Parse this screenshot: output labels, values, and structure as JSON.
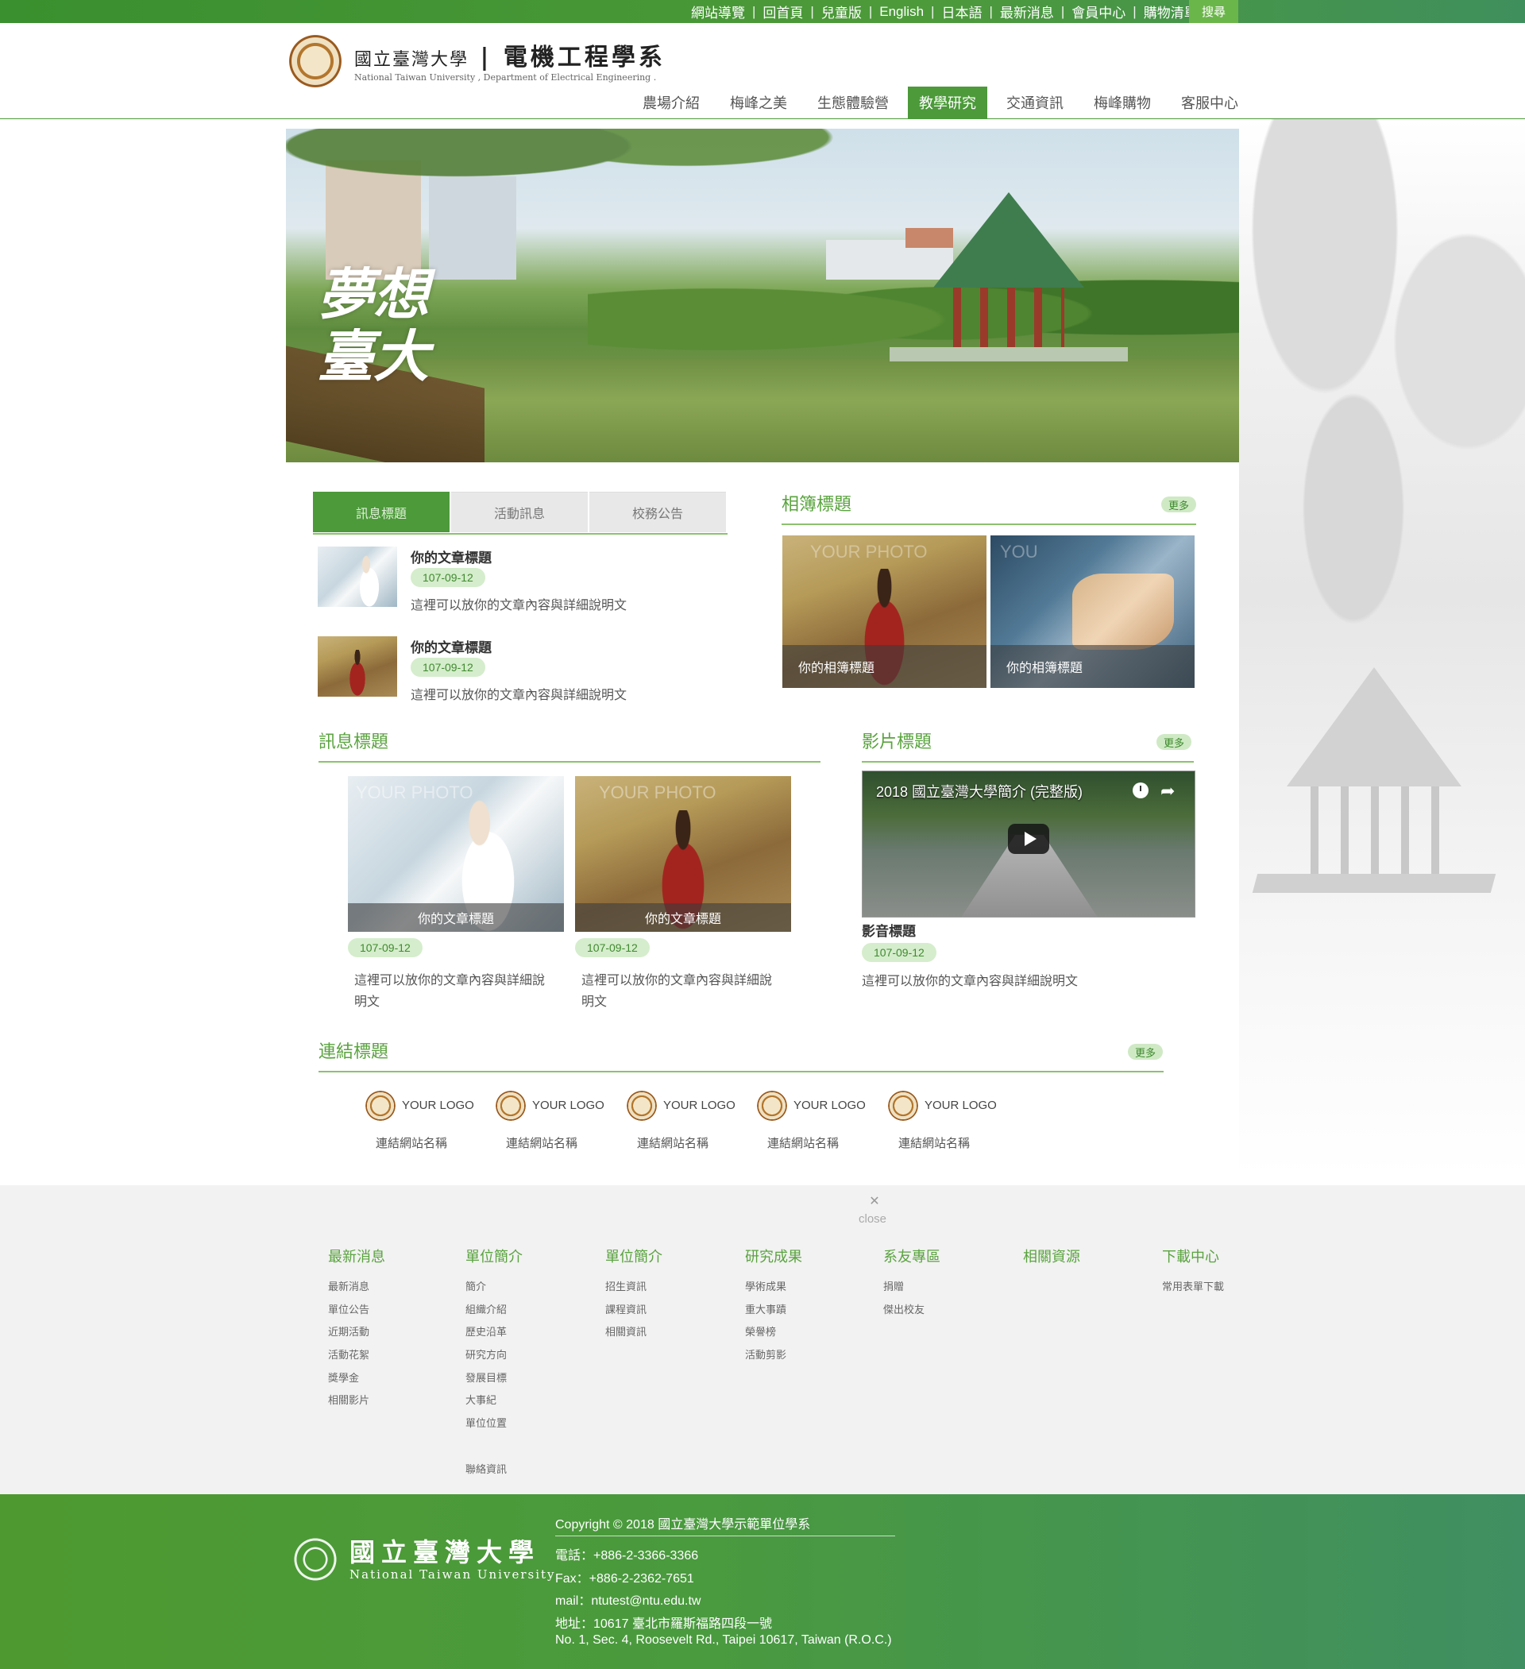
{
  "topbar": {
    "links": [
      "網站導覽",
      "回首頁",
      "兒童版",
      "English",
      "日本語",
      "最新消息",
      "會員中心",
      "購物清單"
    ],
    "search_label": "搜尋"
  },
  "header": {
    "title_cn_small": "國立臺灣大學",
    "title_cn_large": "電機工程學系",
    "subtitle_en": "National Taiwan University , Department of Electrical Engineering ."
  },
  "nav": {
    "items": [
      "農場介紹",
      "梅峰之美",
      "生態體驗營",
      "教學研究",
      "交通資訊",
      "梅峰購物",
      "客服中心"
    ],
    "active_index": 3
  },
  "banner": {
    "calligraphy": "夢想臺大"
  },
  "tabs": [
    "訊息標題",
    "活動訊息",
    "校務公告"
  ],
  "news_list": [
    {
      "title": "你的文章標題",
      "date": "107-09-12",
      "desc": "這裡可以放你的文章內容與詳細說明文"
    },
    {
      "title": "你的文章標題",
      "date": "107-09-12",
      "desc": "這裡可以放你的文章內容與詳細說明文"
    }
  ],
  "album": {
    "title": "相簿標題",
    "more": "更多",
    "items": [
      {
        "caption": "你的相簿標題",
        "watermark": "YOUR PHOTO"
      },
      {
        "caption": "你的相簿標題",
        "watermark": "YOU"
      }
    ]
  },
  "message": {
    "title": "訊息標題",
    "cards": [
      {
        "caption": "你的文章標題",
        "date": "107-09-12",
        "desc": "這裡可以放你的文章內容與詳細說明文",
        "watermark": "YOUR PHOTO"
      },
      {
        "caption": "你的文章標題",
        "date": "107-09-12",
        "desc": "這裡可以放你的文章內容與詳細說明文",
        "watermark": "YOUR PHOTO"
      }
    ]
  },
  "video": {
    "title": "影片標題",
    "more": "更多",
    "video_title": "2018 國立臺灣大學簡介 (完整版)",
    "media_title": "影音標題",
    "date": "107-09-12",
    "desc": "這裡可以放你的文章內容與詳細說明文"
  },
  "links": {
    "title": "連結標題",
    "more": "更多",
    "items": [
      {
        "logo": "YOUR LOGO",
        "name": "連結網站名稱"
      },
      {
        "logo": "YOUR LOGO",
        "name": "連結網站名稱"
      },
      {
        "logo": "YOUR LOGO",
        "name": "連結網站名稱"
      },
      {
        "logo": "YOUR LOGO",
        "name": "連結網站名稱"
      },
      {
        "logo": "YOUR LOGO",
        "name": "連結網站名稱"
      }
    ]
  },
  "sitemap": {
    "close_label": "close",
    "columns": [
      {
        "head": "最新消息",
        "links": [
          "最新消息",
          "單位公告",
          "近期活動",
          "活動花絮",
          "獎學金",
          "相關影片"
        ]
      },
      {
        "head": "單位簡介",
        "links": [
          "簡介",
          "組織介紹",
          "歷史沿革",
          "研究方向",
          "發展目標",
          "大事紀",
          "單位位置",
          "",
          "聯絡資訊"
        ]
      },
      {
        "head": "單位簡介",
        "links": [
          "招生資訊",
          "課程資訊",
          "相關資訊"
        ]
      },
      {
        "head": "研究成果",
        "links": [
          "學術成果",
          "重大事蹟",
          "榮譽榜",
          "活動剪影"
        ]
      },
      {
        "head": "系友專區",
        "links": [
          "捐贈",
          "傑出校友"
        ]
      },
      {
        "head": "相關資源",
        "links": []
      },
      {
        "head": "下載中心",
        "links": [
          "常用表單下載"
        ]
      }
    ]
  },
  "footer": {
    "name_cn": "國立臺灣大學",
    "name_en": "National Taiwan University",
    "copyright": "Copyright © 2018 國立臺灣大學示範單位學系",
    "phone": "電話：+886-2-3366-3366",
    "fax": "Fax：+886-2-2362-7651",
    "mail": "mail：ntutest@ntu.edu.tw",
    "address_cn": "地址：10617 臺北市羅斯福路四段一號",
    "address_en": "No. 1, Sec. 4, Roosevelt Rd., Taipei 10617, Taiwan (R.O.C.)"
  },
  "colors": {
    "brand_green": "#4c9a3a",
    "title_green": "#5aa33f",
    "badge_bg": "#d5edcc",
    "sitemap_bg": "#f2f2f2"
  }
}
